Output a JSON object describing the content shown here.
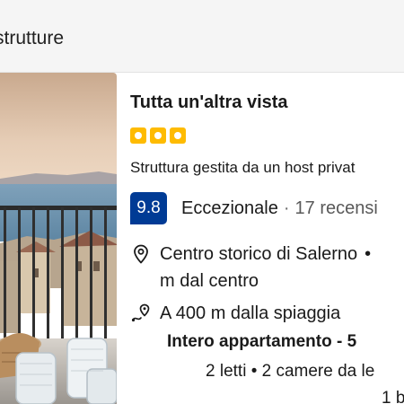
{
  "topbar": {
    "label": "strutture"
  },
  "listing": {
    "title": "Tutta un'altra vista",
    "star_count": 3,
    "host_text": "Struttura gestita da un host privat",
    "score": "9.8",
    "score_label": "Eccezionale",
    "separator": "·",
    "reviews": "17 recensi",
    "location_line1": "Centro storico di Salerno",
    "location_bullet": "•",
    "location_line2": "m dal centro",
    "beach_text": "A 400 m dalla spiaggia",
    "apartment_text": "Intero appartamento - 5",
    "beds_text": "2 letti • 2 camere da le",
    "baths_text": "1 b"
  },
  "colors": {
    "star": "#febb02",
    "score_badge": "#003b95",
    "topbar_bg": "#f5f5f5"
  },
  "icons": {
    "location": "map-pin-icon",
    "beach": "route-pin-icon",
    "star": "star-square-icon"
  }
}
